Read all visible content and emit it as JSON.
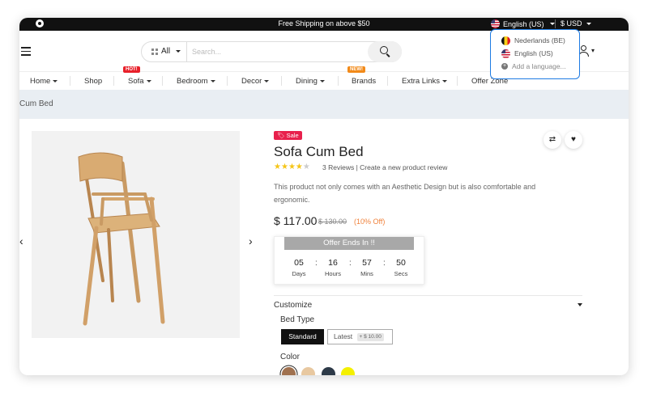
{
  "topbar": {
    "shipping_text": "Free Shipping on above $50",
    "language": "English (US)",
    "currency": "$ USD"
  },
  "language_dropdown": {
    "options": [
      "Nederlands (BE)",
      "English (US)"
    ],
    "add_label": "Add a language..."
  },
  "search": {
    "category": "All",
    "placeholder": "Search..."
  },
  "nav": {
    "items": [
      "Home",
      "Shop",
      "Sofa",
      "Bedroom",
      "Decor",
      "Dining",
      "Brands",
      "Extra Links",
      "Offer Zone"
    ],
    "badges": {
      "hot": "HOT!",
      "new": "NEW!"
    }
  },
  "breadcrumb": "Cum Bed",
  "product": {
    "sale_badge": "Sale",
    "title": "Sofa Cum Bed",
    "rating": 4,
    "rating_max": 5,
    "reviews": "3 Reviews | Create a new product review",
    "description": "This product not only comes with an Aesthetic Design but is also comfortable and ergonomic.",
    "price": "$ 117.00",
    "old_price": "$ 130.00",
    "discount": "(10% Off)"
  },
  "offer": {
    "title": "Offer Ends In !!",
    "countdown": [
      {
        "value": "05",
        "label": "Days"
      },
      {
        "value": "16",
        "label": "Hours"
      },
      {
        "value": "57",
        "label": "Mins"
      },
      {
        "value": "50",
        "label": "Secs"
      }
    ]
  },
  "customize": {
    "title": "Customize",
    "bed_type_label": "Bed Type",
    "bed_types": [
      {
        "label": "Standard",
        "extra": ""
      },
      {
        "label": "Latest",
        "extra": "+ $ 10.00"
      }
    ],
    "color_label": "Color",
    "colors": [
      "#a0714f",
      "#e8c8a0",
      "#2d3a48",
      "#f4f000"
    ]
  }
}
